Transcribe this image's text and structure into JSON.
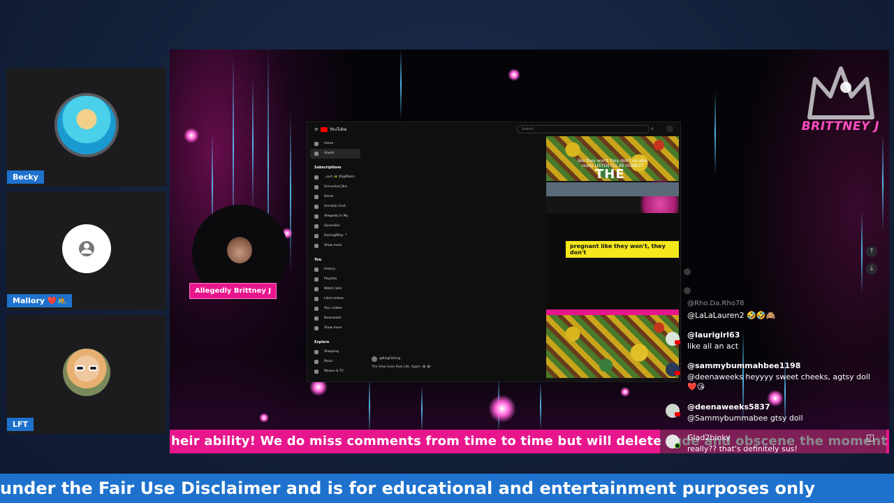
{
  "participants": [
    {
      "name": "Becky",
      "avatar": "becky-avatar"
    },
    {
      "name": "Mallory ❤️🤼",
      "avatar": "user-placeholder-icon"
    },
    {
      "name": "LFT",
      "avatar": "lft-avatar"
    }
  ],
  "stream": {
    "host_label": "Allegedly Brittney J",
    "brand": "BRITTNEY J",
    "ticker": "heir ability! We do miss comments from time to time but will delete rude and obscene the moment"
  },
  "youtube": {
    "logo": "YouTube",
    "search_placeholder": "Search",
    "nav": [
      "Home",
      "Shorts"
    ],
    "subscriptions_head": "Subscriptions",
    "subscriptions": [
      "..ourt ✨ (DigiMom)",
      "Unraveled_Bre..",
      "Denar",
      "Unreally Chef..",
      "Allegedly In My ..",
      "Queenlike",
      "DarlingMilky ™"
    ],
    "show_more": "Show more",
    "you_head": "You",
    "you_items": [
      "History",
      "Playlists",
      "Watch later",
      "Liked videos",
      "Your videos",
      "Downloads"
    ],
    "show_more_2": "Show more",
    "explore_head": "Explore",
    "explore_items": [
      "Shopping",
      "Music",
      "Movies & TV"
    ],
    "short_caption": "like they won't they don't no also really LISTEN I'LL BE HONEST",
    "short_title": "THE",
    "yellow_caption": "pregnant like they won't, they don't",
    "channel": "@KingFishing",
    "video_meta": "The View Goes Real Life. Again. 😂 😂"
  },
  "chat": [
    {
      "user": "@Rho.Da.Rho78",
      "text": "@LaLaLauren2 🤣🤣🙈",
      "faded": true
    },
    {
      "user": "@laurigirl63",
      "text": "like all an act",
      "faded": false
    },
    {
      "user": "@sammybummahbee1198",
      "text": "@deenaweeks heyyyy sweet cheeks, agtsy doll ❤️😘",
      "faded": false
    },
    {
      "user": "@deenaweeks5837",
      "text": "@Sammybummabee gtsy doll",
      "faded": false
    },
    {
      "user": "Glad2binky",
      "text": "really?? that's definitely sus!",
      "faded": false
    }
  ],
  "banner": "under the Fair Use Disclaimer and is for educational and entertainment purposes only",
  "colors": {
    "accent_blue": "#1e72ce",
    "accent_pink": "#e8168c"
  }
}
